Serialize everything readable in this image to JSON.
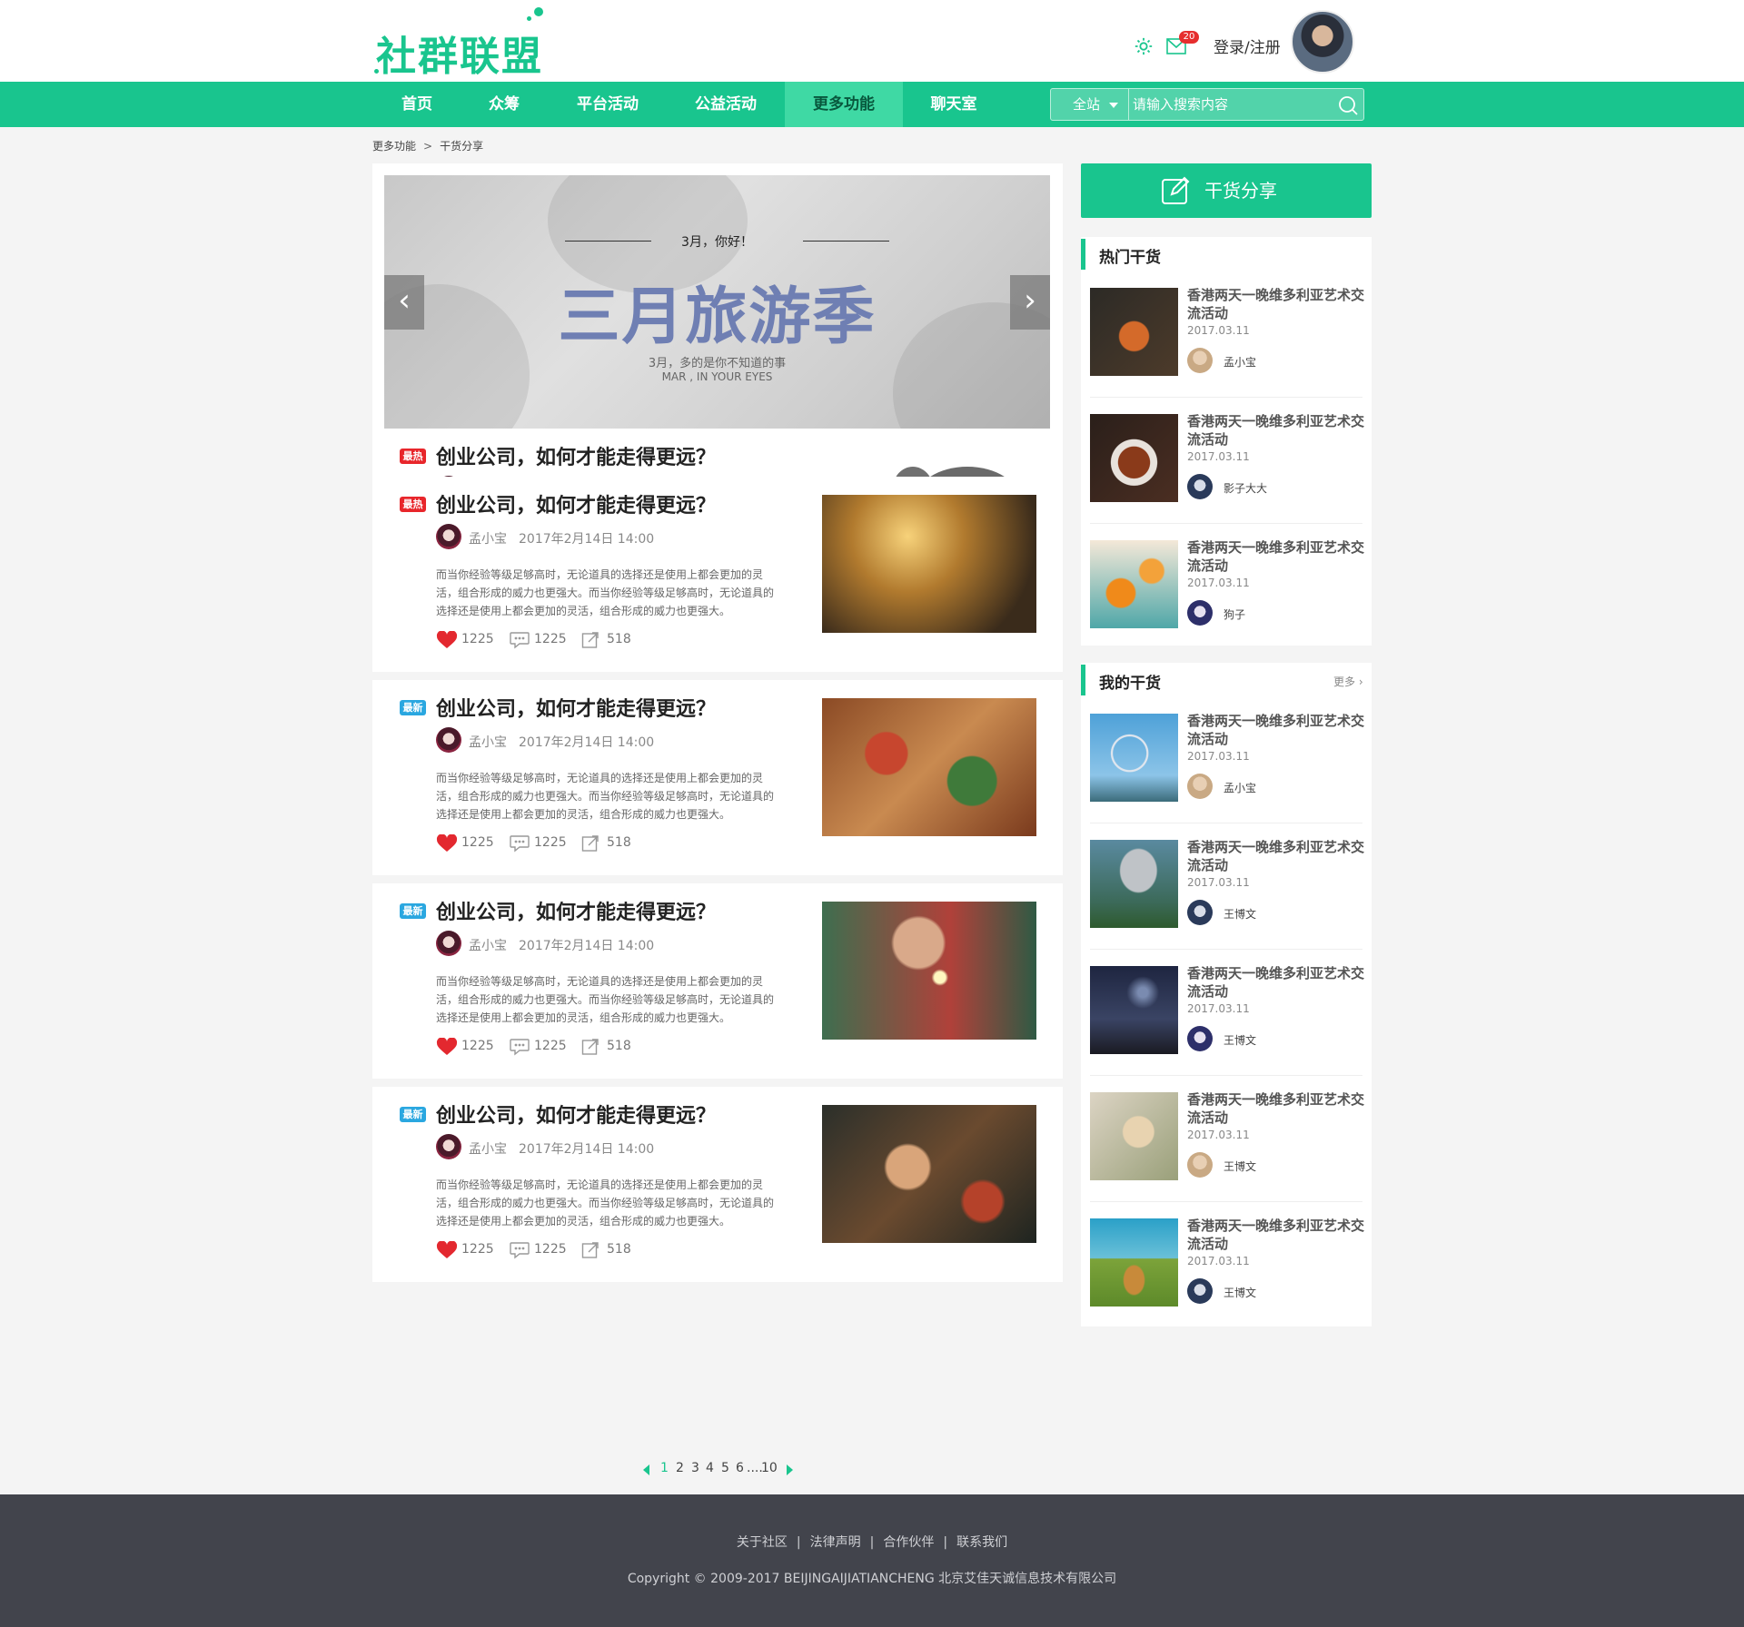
{
  "header": {
    "logo_text": "社群联盟",
    "mail_count": "20",
    "login_label": "登录/注册"
  },
  "nav": {
    "items": [
      {
        "label": "首页"
      },
      {
        "label": "众筹"
      },
      {
        "label": "平台活动"
      },
      {
        "label": "公益活动"
      },
      {
        "label": "更多功能",
        "active": true
      },
      {
        "label": "聊天室"
      }
    ],
    "search_scope": "全站",
    "search_placeholder": "请输入搜索内容"
  },
  "breadcrumb": {
    "parent": "更多功能",
    "current": "干货分享"
  },
  "banner": {
    "small_text": "3月，你好！",
    "title": "三月旅游季",
    "subtitle": "3月，多的是你不知道的事",
    "subtitle_en": "MAR , IN YOUR EYES",
    "prev_label": "‹",
    "next_label": "›"
  },
  "posts": [
    {
      "tag": "最热",
      "tag_color": "#e8262b",
      "title": "创业公司，如何才能走得更远？",
      "author": "孟小宝",
      "date": "2017年2月14日  14:00",
      "excerpt": "而当你经验等级足够高时，无论道具的选择还是使用上都会更加的灵活，组合形成的威力也更强大。而当你经验等级足够高时，无论道具的选择还是使用上都会更加的灵活，组合形成的威力也更强大。",
      "likes": "1225",
      "comments": "1225",
      "shares": "518",
      "image": "elephant-rope-photo"
    },
    {
      "tag": "最热",
      "tag_color": "#e8262b",
      "title": "创业公司，如何才能走得更远？",
      "author": "孟小宝",
      "date": "2017年2月14日  14:00",
      "excerpt": "而当你经验等级足够高时，无论道具的选择还是使用上都会更加的灵活，组合形成的威力也更强大。而当你经验等级足够高时，无论道具的选择还是使用上都会更加的灵活，组合形成的威力也更强大。",
      "likes": "1225",
      "comments": "1225",
      "shares": "518",
      "image": "scooter-sunset-photo"
    },
    {
      "tag": "最新",
      "tag_color": "#2aa7e0",
      "title": "创业公司，如何才能走得更远？",
      "author": "孟小宝",
      "date": "2017年2月14日  14:00",
      "excerpt": "而当你经验等级足够高时，无论道具的选择还是使用上都会更加的灵活，组合形成的威力也更强大。而当你经验等级足够高时，无论道具的选择还是使用上都会更加的灵活，组合形成的威力也更强大。",
      "likes": "1225",
      "comments": "1225",
      "shares": "518",
      "image": "gingerbread-cookies-photo"
    },
    {
      "tag": "最新",
      "tag_color": "#2aa7e0",
      "title": "创业公司，如何才能走得更远？",
      "author": "孟小宝",
      "date": "2017年2月14日  14:00",
      "excerpt": "而当你经验等级足够高时，无论道具的选择还是使用上都会更加的灵活，组合形成的威力也更强大。而当你经验等级足够高时，无论道具的选择还是使用上都会更加的灵活，组合形成的威力也更强大。",
      "likes": "1225",
      "comments": "1225",
      "shares": "518",
      "image": "sparkler-girl-photo"
    },
    {
      "tag": "最新",
      "tag_color": "#2aa7e0",
      "title": "创业公司，如何才能走得更远？",
      "author": "孟小宝",
      "date": "2017年2月14日  14:00",
      "excerpt": "而当你经验等级足够高时，无论道具的选择还是使用上都会更加的灵活，组合形成的威力也更强大。而当你经验等级足够高时，无论道具的选择还是使用上都会更加的灵活，组合形成的威力也更强大。",
      "likes": "1225",
      "comments": "1225",
      "shares": "518",
      "image": "girl-roses-photo"
    }
  ],
  "pagination": {
    "pages": [
      "1",
      "2",
      "3",
      "4",
      "5",
      "6",
      "....",
      "10"
    ],
    "current": "1"
  },
  "sidebar": {
    "share_button": "干货分享",
    "hot": {
      "title": "热门干货",
      "items": [
        {
          "title": "香港两天一晚维多利亚艺术交流活动",
          "date": "2017.03.11",
          "author": "孟小宝",
          "image": "cocktail-jar-photo"
        },
        {
          "title": "香港两天一晚维多利亚艺术交流活动",
          "date": "2017.03.11",
          "author": "影子大大",
          "image": "roast-dish-photo"
        },
        {
          "title": "香港两天一晚维多利亚艺术交流活动",
          "date": "2017.03.11",
          "author": "狗子",
          "image": "orange-jam-photo"
        }
      ]
    },
    "mine": {
      "title": "我的干货",
      "more": "更多 ›",
      "items": [
        {
          "title": "香港两天一晚维多利亚艺术交流活动",
          "date": "2017.03.11",
          "author": "孟小宝",
          "image": "ferris-wheel-photo"
        },
        {
          "title": "香港两天一晚维多利亚艺术交流活动",
          "date": "2017.03.11",
          "author": "王博文",
          "image": "mushroom-photo"
        },
        {
          "title": "香港两天一晚维多利亚艺术交流活动",
          "date": "2017.03.11",
          "author": "王博文",
          "image": "night-sky-tree-photo"
        },
        {
          "title": "香港两天一晚维多利亚艺术交流活动",
          "date": "2017.03.11",
          "author": "王博文",
          "image": "picnic-basket-photo"
        },
        {
          "title": "香港两天一晚维多利亚艺术交流活动",
          "date": "2017.03.11",
          "author": "王博文",
          "image": "cow-seaside-photo"
        }
      ]
    }
  },
  "footer": {
    "links": [
      "关于社区",
      "法律声明",
      "合作伙伴",
      "联系我们"
    ],
    "separator": "|",
    "copyright": "Copyright © 2009-2017 BEIJINGAIJIATIANCHENG 北京艾佳天诚信息技术有限公司"
  },
  "colors": {
    "brand": "#19c58e",
    "hot_tag": "#e8262b",
    "new_tag": "#2aa7e0",
    "footer_bg": "#42444c"
  }
}
